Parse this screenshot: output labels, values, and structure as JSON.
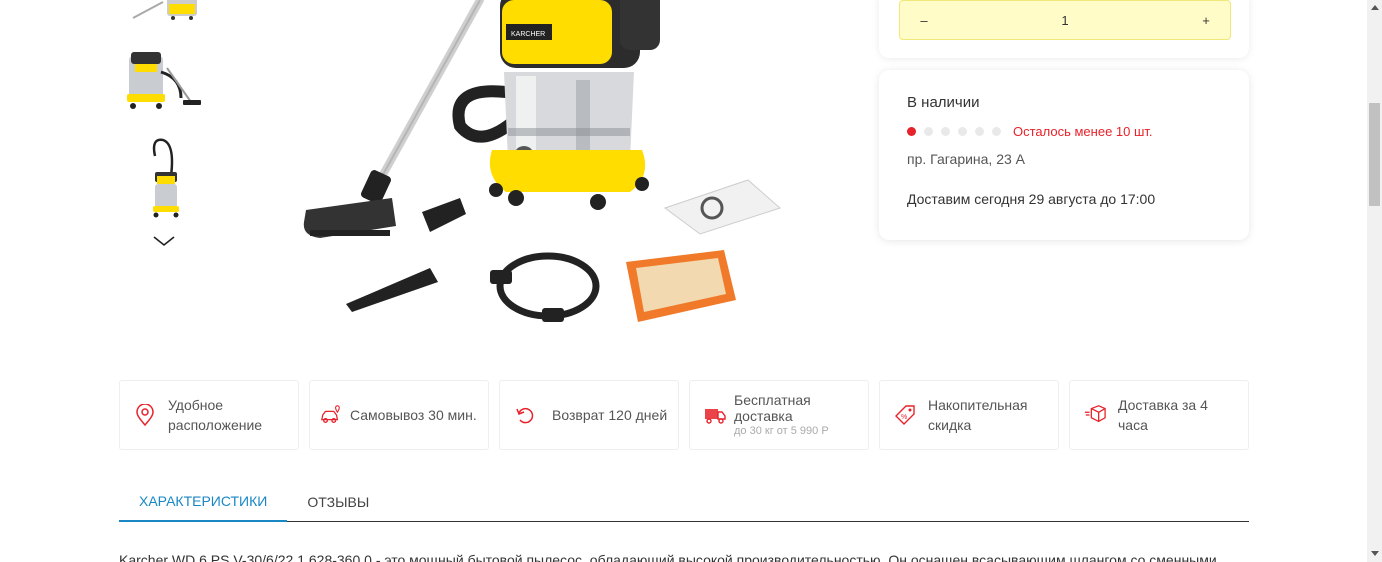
{
  "quantity": {
    "minus": "–",
    "value": "1",
    "plus": "+"
  },
  "availability": {
    "status": "В наличии",
    "stock_level_filled": 1,
    "stock_level_total": 6,
    "stock_text": "Осталось менее 10 шт.",
    "address": "пр. Гагарина, 23 А",
    "delivery": "Доставим сегодня 29 августа до 17:00",
    "accent_color": "#e8222a"
  },
  "features": [
    {
      "icon": "location-pin-icon",
      "title": "Удобное расположение",
      "sub": ""
    },
    {
      "icon": "car-pickup-icon",
      "title": "Самовывоз 30 мин.",
      "sub": ""
    },
    {
      "icon": "return-icon",
      "title": "Возврат 120 дней",
      "sub": ""
    },
    {
      "icon": "delivery-truck-icon",
      "title": "Бесплатная доставка",
      "sub": "до 30 кг от 5 990 Р"
    },
    {
      "icon": "discount-tag-icon",
      "title": "Накопительная скидка",
      "sub": ""
    },
    {
      "icon": "package-box-icon",
      "title": "Доставка за 4 часа",
      "sub": ""
    }
  ],
  "tabs": [
    {
      "label": "ХАРАКТЕРИСТИКИ",
      "active": true
    },
    {
      "label": "ОТЗЫВЫ",
      "active": false
    }
  ],
  "description": "Karcher WD 6 PS V-30/6/22 1.628-360.0 - это мощный бытовой пылесос, обладающий высокой производительностью. Он оснащен всасывающим шлангом со сменными",
  "colors": {
    "tab_active": "#1a87c5",
    "qty_bg": "#fffcc7",
    "brand_yellow": "#ffdd00"
  }
}
